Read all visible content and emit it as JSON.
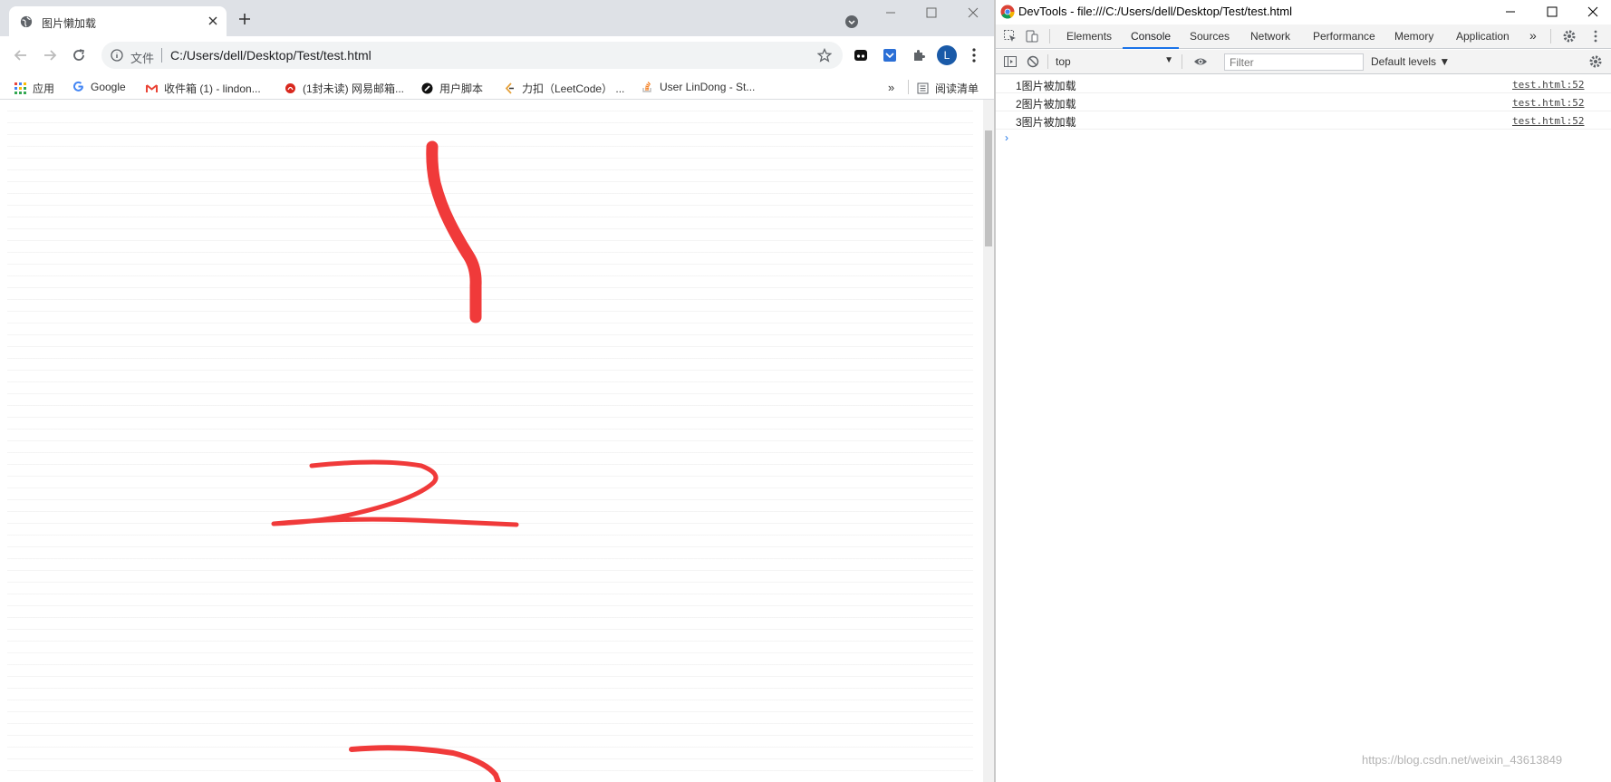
{
  "browser": {
    "tab": {
      "title": "图片懒加载",
      "icon": "globe-icon"
    },
    "address_bar": {
      "scheme_label": "文件",
      "url": "C:/Users/dell/Desktop/Test/test.html"
    },
    "profile_initial": "L",
    "bookmarks": [
      {
        "label": "应用",
        "icon": "apps-grid-icon"
      },
      {
        "label": "Google",
        "icon": "google-icon"
      },
      {
        "label": "收件箱 (1) - lindon...",
        "icon": "gmail-icon"
      },
      {
        "label": "(1封未读) 网易邮箱...",
        "icon": "netease-mail-icon"
      },
      {
        "label": "用户脚本",
        "icon": "userscript-icon"
      },
      {
        "label": "力扣（LeetCode） ...",
        "icon": "leetcode-icon"
      },
      {
        "label": "User LinDong - St...",
        "icon": "stackoverflow-icon"
      }
    ],
    "reading_list_label": "阅读清单",
    "page_content": {
      "drawn_digits": [
        "1",
        "2",
        "3"
      ],
      "stroke_color": "#f03a3a"
    }
  },
  "devtools": {
    "window_title": "DevTools - file:///C:/Users/dell/Desktop/Test/test.html",
    "tabs": [
      "Elements",
      "Console",
      "Sources",
      "Network",
      "Performance",
      "Memory",
      "Application"
    ],
    "active_tab": "Console",
    "context": "top",
    "filter_placeholder": "Filter",
    "levels_label": "Default levels ▼",
    "log": [
      {
        "message": "1图片被加载",
        "source": "test.html:52"
      },
      {
        "message": "2图片被加载",
        "source": "test.html:52"
      },
      {
        "message": "3图片被加载",
        "source": "test.html:52"
      }
    ],
    "prompt_symbol": "›",
    "accent_color": "#1a73e8"
  },
  "watermark": "https://blog.csdn.net/weixin_43613849"
}
